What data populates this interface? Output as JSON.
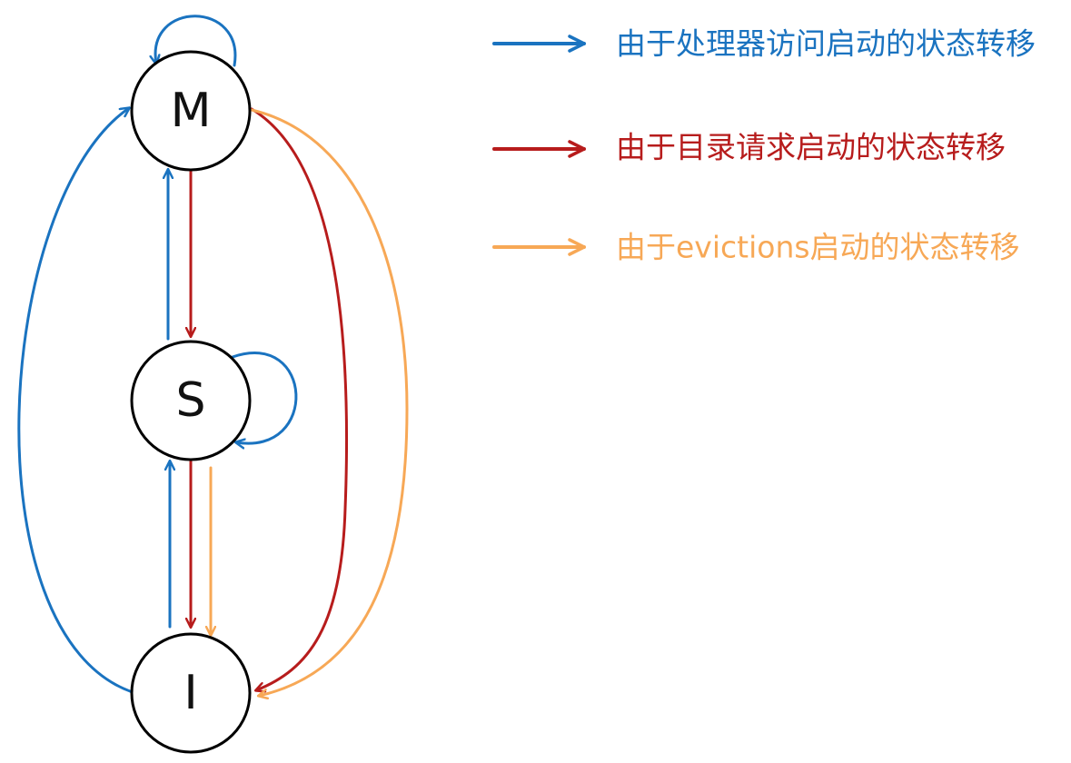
{
  "states": [
    {
      "id": "M",
      "label": "M"
    },
    {
      "id": "S",
      "label": "S"
    },
    {
      "id": "I",
      "label": "I"
    }
  ],
  "colors": {
    "processor": "#1a73c0",
    "directory": "#b71c1c",
    "eviction": "#f7a856",
    "node_stroke": "#000000",
    "node_label": "#111111"
  },
  "legend": [
    {
      "key": "processor",
      "label": "由于处理器访问启动的状态转移"
    },
    {
      "key": "directory",
      "label": "由于目录请求启动的状态转移"
    },
    {
      "key": "eviction",
      "label": "由于evictions启动的状态转移"
    }
  ],
  "transitions": [
    {
      "from": "M",
      "to": "M",
      "kind": "processor"
    },
    {
      "from": "S",
      "to": "S",
      "kind": "processor"
    },
    {
      "from": "S",
      "to": "M",
      "kind": "processor"
    },
    {
      "from": "I",
      "to": "S",
      "kind": "processor"
    },
    {
      "from": "I",
      "to": "M",
      "kind": "processor"
    },
    {
      "from": "M",
      "to": "S",
      "kind": "directory"
    },
    {
      "from": "S",
      "to": "I",
      "kind": "directory"
    },
    {
      "from": "M",
      "to": "I",
      "kind": "directory"
    },
    {
      "from": "S",
      "to": "I",
      "kind": "eviction"
    },
    {
      "from": "M",
      "to": "I",
      "kind": "eviction"
    }
  ]
}
